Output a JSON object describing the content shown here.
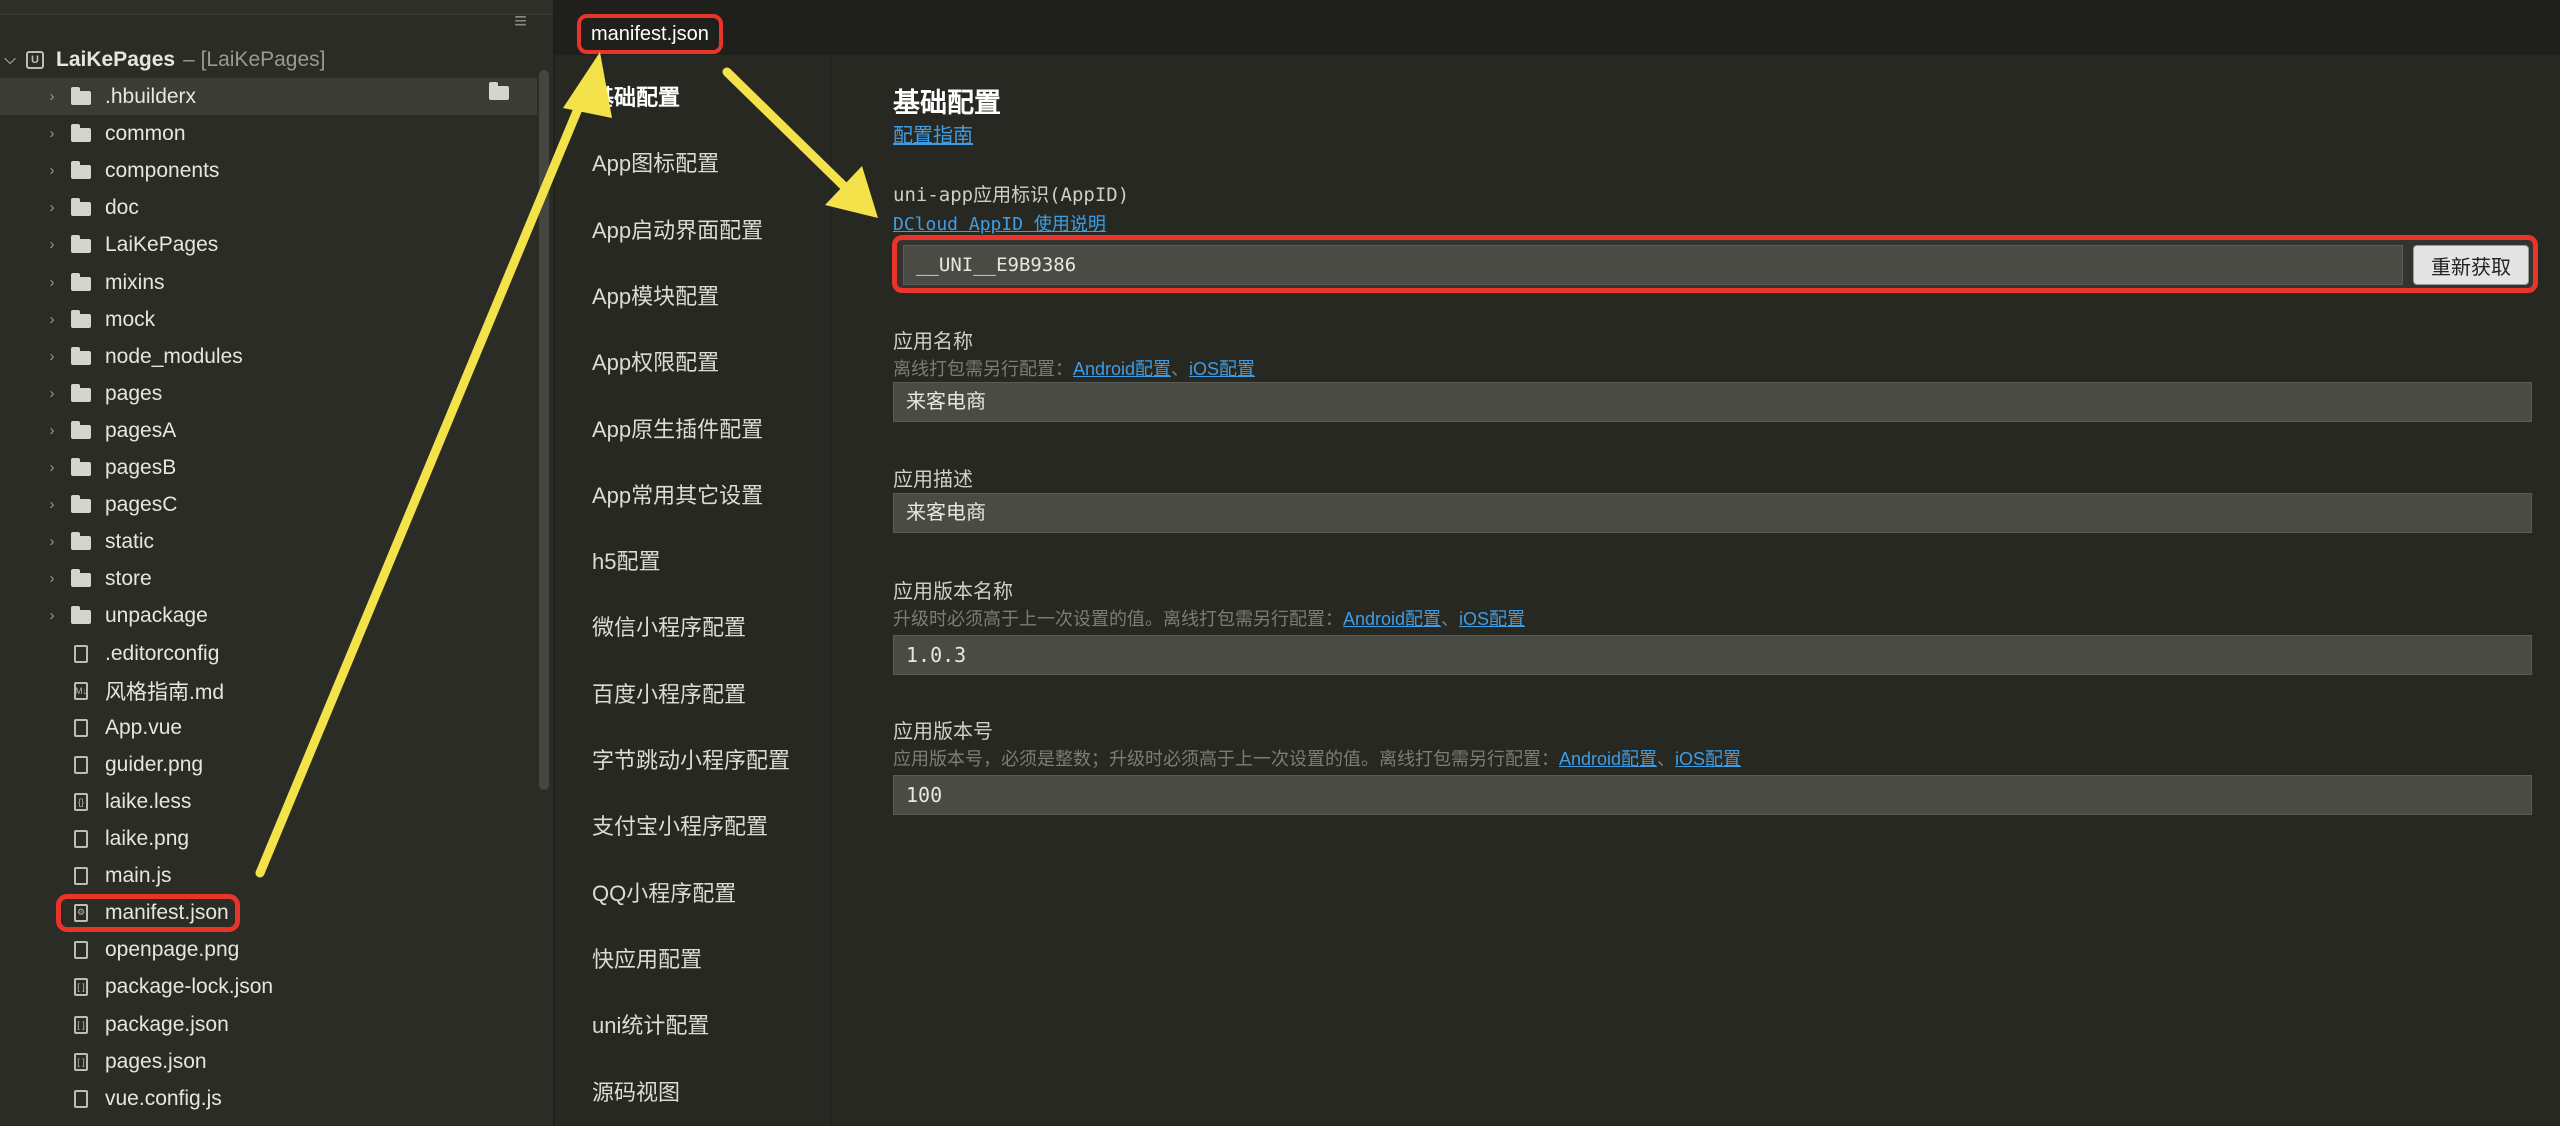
{
  "tab": {
    "label": "manifest.json"
  },
  "project": {
    "name": "LaiKePages",
    "path": "– [LaiKePages]"
  },
  "tree": [
    {
      "name": ".hbuilderx",
      "type": "folder",
      "icon": "folder-icon",
      "selected": true
    },
    {
      "name": "common",
      "type": "folder",
      "icon": "folder-icon"
    },
    {
      "name": "components",
      "type": "folder",
      "icon": "folder-icon"
    },
    {
      "name": "doc",
      "type": "folder",
      "icon": "folder-icon"
    },
    {
      "name": "LaiKePages",
      "type": "folder",
      "icon": "folder-icon"
    },
    {
      "name": "mixins",
      "type": "folder",
      "icon": "folder-icon"
    },
    {
      "name": "mock",
      "type": "folder",
      "icon": "folder-icon"
    },
    {
      "name": "node_modules",
      "type": "folder",
      "icon": "folder-icon"
    },
    {
      "name": "pages",
      "type": "folder",
      "icon": "folder-icon"
    },
    {
      "name": "pagesA",
      "type": "folder",
      "icon": "folder-icon"
    },
    {
      "name": "pagesB",
      "type": "folder",
      "icon": "folder-icon"
    },
    {
      "name": "pagesC",
      "type": "folder",
      "icon": "folder-icon"
    },
    {
      "name": "static",
      "type": "folder",
      "icon": "folder-icon"
    },
    {
      "name": "store",
      "type": "folder",
      "icon": "folder-icon"
    },
    {
      "name": "unpackage",
      "type": "folder",
      "icon": "folder-icon"
    },
    {
      "name": ".editorconfig",
      "type": "file",
      "icon": "file-icon",
      "glyph": ""
    },
    {
      "name": "风格指南.md",
      "type": "file",
      "icon": "markdown-icon",
      "glyph": "M↓"
    },
    {
      "name": "App.vue",
      "type": "file",
      "icon": "vue-file-icon",
      "glyph": ""
    },
    {
      "name": "guider.png",
      "type": "file",
      "icon": "image-file-icon",
      "glyph": ""
    },
    {
      "name": "laike.less",
      "type": "file",
      "icon": "style-file-icon",
      "glyph": "{}"
    },
    {
      "name": "laike.png",
      "type": "file",
      "icon": "image-file-icon",
      "glyph": ""
    },
    {
      "name": "main.js",
      "type": "file",
      "icon": "js-file-icon",
      "glyph": ""
    },
    {
      "name": "manifest.json",
      "type": "file",
      "icon": "manifest-file-icon",
      "glyph": "⚙",
      "highlighted": true
    },
    {
      "name": "openpage.png",
      "type": "file",
      "icon": "image-file-icon",
      "glyph": ""
    },
    {
      "name": "package-lock.json",
      "type": "file",
      "icon": "json-file-icon",
      "glyph": "[ ]"
    },
    {
      "name": "package.json",
      "type": "file",
      "icon": "json-file-icon",
      "glyph": "[ ]"
    },
    {
      "name": "pages.json",
      "type": "file",
      "icon": "json-file-icon",
      "glyph": "[ ]"
    },
    {
      "name": "vue.config.js",
      "type": "file",
      "icon": "js-file-icon",
      "glyph": ""
    }
  ],
  "config_menu": [
    "基础配置",
    "App图标配置",
    "App启动界面配置",
    "App模块配置",
    "App权限配置",
    "App原生插件配置",
    "App常用其它设置",
    "h5配置",
    "微信小程序配置",
    "百度小程序配置",
    "字节跳动小程序配置",
    "支付宝小程序配置",
    "QQ小程序配置",
    "快应用配置",
    "uni统计配置",
    "源码视图"
  ],
  "form": {
    "title": "基础配置",
    "guide_link": "配置指南",
    "appid_label": "uni-app应用标识(AppID)",
    "appid_link": "DCloud AppID 使用说明",
    "appid_value": "__UNI__E9B9386",
    "refresh_label": "重新获取",
    "name_label": "应用名称",
    "name_hint": "离线打包需另行配置：",
    "android_link": "Android配置",
    "sep": "、",
    "ios_link": "iOS配置",
    "name_value": "来客电商",
    "desc_label": "应用描述",
    "desc_value": "来客电商",
    "vername_label": "应用版本名称",
    "vername_hint": "升级时必须高于上一次设置的值。离线打包需另行配置：",
    "vername_value": "1.0.3",
    "vercode_label": "应用版本号",
    "vercode_hint": "应用版本号，必须是整数；升级时必须高于上一次设置的值。离线打包需另行配置：",
    "vercode_value": "100"
  },
  "colors": {
    "highlight": "#e8342a",
    "arrow": "#f3e24a",
    "link": "#3f9de6",
    "background": "#272822"
  }
}
